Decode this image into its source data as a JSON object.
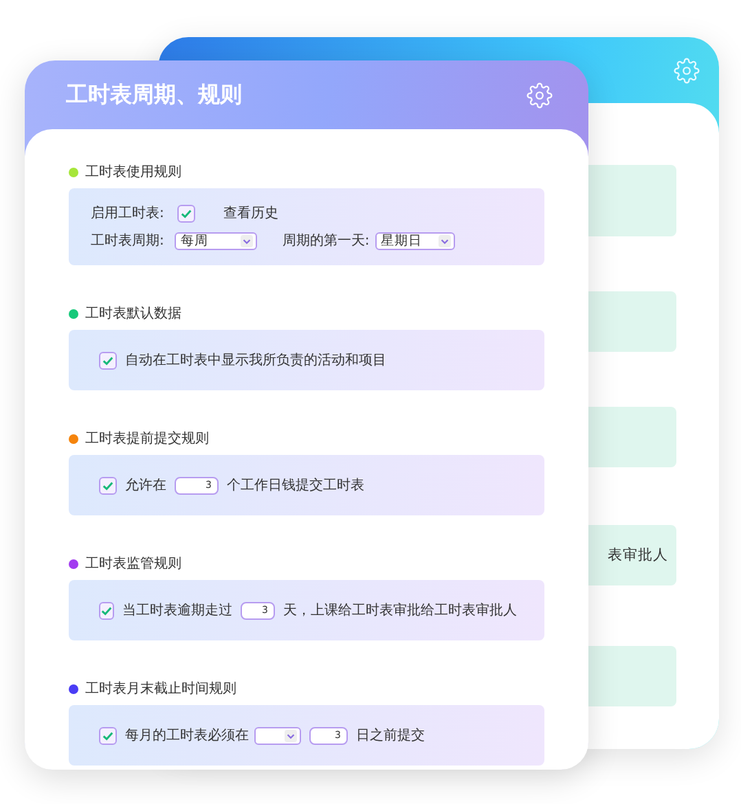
{
  "back_window": {
    "fragment": "表审批人"
  },
  "window": {
    "title": "工时表周期、规则"
  },
  "sections": [
    {
      "title": "工时表使用规则",
      "color": "#a6e63a",
      "rows": [
        [
          {
            "kind": "label",
            "text": "启用工时表:"
          },
          {
            "kind": "checkbox",
            "checked": true
          },
          {
            "kind": "link",
            "text": "查看历史"
          }
        ],
        [
          {
            "kind": "label",
            "text": "工时表周期:"
          },
          {
            "kind": "select",
            "value": "每周"
          },
          {
            "kind": "label",
            "text": "周期的第一天:"
          },
          {
            "kind": "select",
            "value": "星期日"
          }
        ]
      ]
    },
    {
      "title": "工时表默认数据",
      "color": "#16c97a",
      "rows": [
        [
          {
            "kind": "checkbox",
            "checked": true
          },
          {
            "kind": "label",
            "text": "自动在工时表中显示我所负责的活动和项目"
          }
        ]
      ]
    },
    {
      "title": "工时表提前提交规则",
      "color": "#f5840c",
      "rows": [
        [
          {
            "kind": "checkbox",
            "checked": true
          },
          {
            "kind": "label",
            "text": "允许在"
          },
          {
            "kind": "number",
            "value": "3"
          },
          {
            "kind": "label",
            "text": "个工作日钱提交工时表"
          }
        ]
      ]
    },
    {
      "title": "工时表监管规则",
      "color": "#a23cf0",
      "rows": [
        [
          {
            "kind": "checkbox",
            "checked": true
          },
          {
            "kind": "label",
            "text": "当工时表逾期走过"
          },
          {
            "kind": "number",
            "value": "3"
          },
          {
            "kind": "label",
            "text": "天，上课给工时表审批给工时表审批人"
          }
        ]
      ]
    },
    {
      "title": "工时表月末截止时间规则",
      "color": "#4a3cf5",
      "rows": [
        [
          {
            "kind": "checkbox",
            "checked": true
          },
          {
            "kind": "label",
            "text": "每月的工时表必须在"
          },
          {
            "kind": "select"
          },
          {
            "kind": "number",
            "value": "3"
          },
          {
            "kind": "label",
            "text": "日之前提交"
          }
        ]
      ]
    }
  ]
}
